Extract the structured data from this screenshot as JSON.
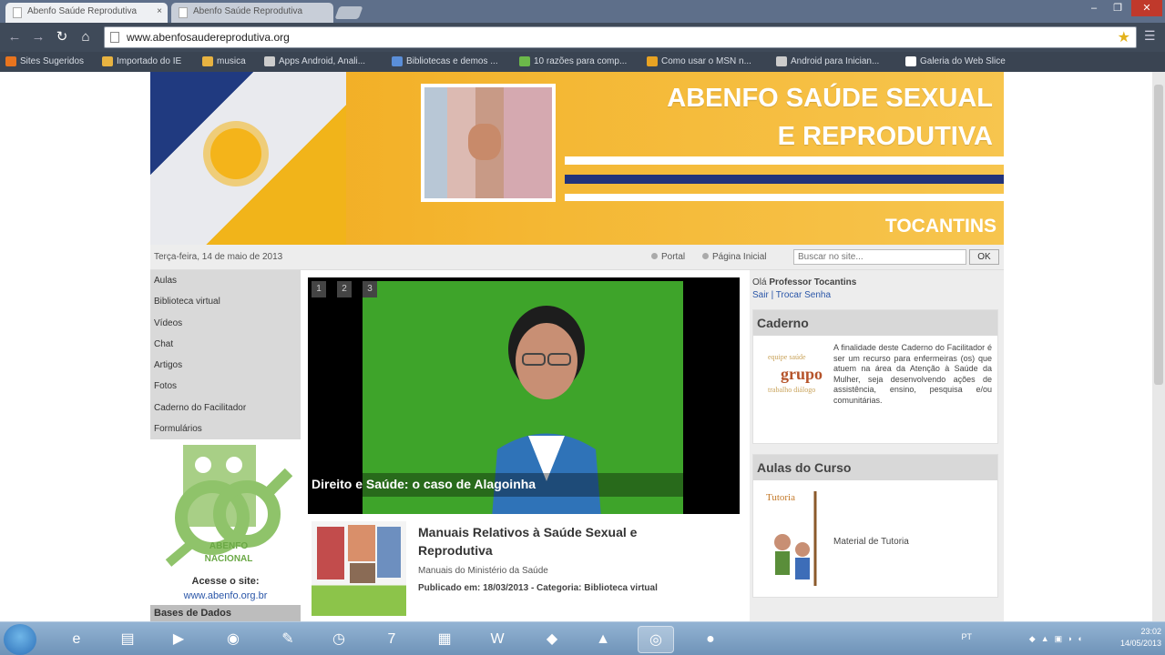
{
  "browser": {
    "tabs": [
      {
        "label": "Abenfo Saúde Reprodutiva",
        "close": "×"
      },
      {
        "label": "Abenfo Saúde Reprodutiva"
      }
    ],
    "url": "www.abenfosaudereprodutiva.org",
    "bookmarks": [
      {
        "label": "Sites Sugeridos",
        "color": "#e8741e"
      },
      {
        "label": "Importado do IE",
        "color": "#e8b341"
      },
      {
        "label": "musica",
        "color": "#e8b341"
      },
      {
        "label": "Apps Android, Anali...",
        "color": "#cccccc"
      },
      {
        "label": "Bibliotecas e demos ...",
        "color": "#5a8ed8"
      },
      {
        "label": "10 razões para comp...",
        "color": "#6cb84a"
      },
      {
        "label": "Como usar o MSN n...",
        "color": "#e8a323"
      },
      {
        "label": "Android para Inician...",
        "color": "#cccccc"
      },
      {
        "label": "Galeria do Web Slice",
        "color": "#ffffff"
      }
    ]
  },
  "site": {
    "banner": {
      "title_line1": "ABENFO SAÚDE SEXUAL",
      "title_line2": "E REPRODUTIVA",
      "subtitle": "TOCANTINS"
    },
    "infobar": {
      "date": "Terça-feira, 14 de maio de 2013",
      "portal": "Portal",
      "home": "Página Inicial",
      "search_placeholder": "Buscar no site...",
      "ok": "OK"
    },
    "menu": [
      "Aulas",
      "Biblioteca virtual",
      "Vídeos",
      "Chat",
      "Artigos",
      "Fotos",
      "Caderno do Facilitador",
      "Formulários"
    ],
    "logo_text": "ABENFO NACIONAL",
    "access_label": "Acesse o site:",
    "access_url": "www.abenfo.org.br",
    "bases_label": "Bases de Dados",
    "slider": {
      "numbers": [
        "1",
        "2",
        "3"
      ],
      "caption": "Direito e Saúde: o caso de Alagoinha"
    },
    "article": {
      "title": "Manuais Relativos à Saúde Sexual e Reprodutiva",
      "subtitle": "Manuais do Ministério da Saúde",
      "meta": "Publicado em: 18/03/2013 - Categoria: Biblioteca virtual"
    },
    "user": {
      "greeting": "Olá",
      "name": "Professor Tocantins",
      "logout": "Sair",
      "sep": "|",
      "change_password": "Trocar Senha"
    },
    "caderno": {
      "title": "Caderno",
      "text": "A finalidade deste Caderno do Facilitador é ser um recurso para enfermeiras (os) que atuem na área da Atenção à Saúde da Mulher, seja desenvolvendo ações de assistência, ensino, pesquisa e/ou comunitárias.",
      "image_word": "grupo"
    },
    "aulas": {
      "title": "Aulas do Curso",
      "image_label": "Tutoria",
      "text": "Material de Tutoria"
    }
  },
  "taskbar": {
    "language": "PT",
    "time": "23:02",
    "date": "14/05/2013"
  }
}
